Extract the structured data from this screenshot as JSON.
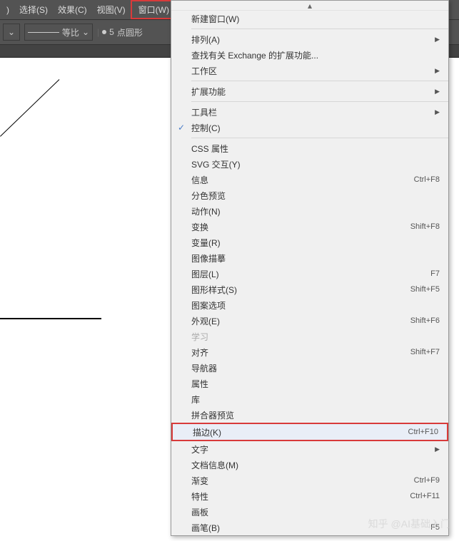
{
  "menubar": {
    "item0": ")",
    "select": "选择(S)",
    "effect": "效果(C)",
    "view": "视图(V)",
    "window": "窗口(W)"
  },
  "toolbar": {
    "ratio": "等比",
    "pt_value": "5",
    "pt_label": "点圆形"
  },
  "menu": {
    "new_window": "新建窗口(W)",
    "arrange": "排列(A)",
    "exchange": "查找有关 Exchange 的扩展功能...",
    "workspace": "工作区",
    "extensions": "扩展功能",
    "toolbar": "工具栏",
    "control": "控制(C)",
    "css_props": "CSS 属性",
    "svg_interact": "SVG 交互(Y)",
    "info": "信息",
    "info_sc": "Ctrl+F8",
    "sep_preview": "分色预览",
    "actions": "动作(N)",
    "transform": "变换",
    "transform_sc": "Shift+F8",
    "variables": "变量(R)",
    "image_trace": "图像描摹",
    "layers": "图层(L)",
    "layers_sc": "F7",
    "graphic_styles": "图形样式(S)",
    "graphic_styles_sc": "Shift+F5",
    "pattern_opts": "图案选项",
    "appearance": "外观(E)",
    "appearance_sc": "Shift+F6",
    "learn": "学习",
    "align": "对齐",
    "align_sc": "Shift+F7",
    "navigator": "导航器",
    "attributes": "属性",
    "libraries": "库",
    "flattener": "拼合器预览",
    "stroke": "描边(K)",
    "stroke_sc": "Ctrl+F10",
    "type": "文字",
    "doc_info": "文档信息(M)",
    "gradient": "渐变",
    "gradient_sc": "Ctrl+F9",
    "magic_wand": "特性",
    "magic_wand_sc": "Ctrl+F11",
    "artboards": "画板",
    "brushes": "画笔(B)",
    "brushes_sc": "F5"
  },
  "watermark": "知乎 @AI基础入门"
}
